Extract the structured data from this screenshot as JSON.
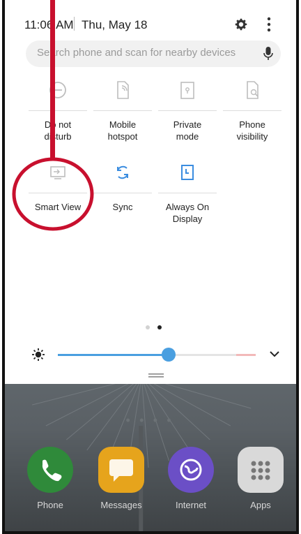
{
  "status_bar": {
    "time": "11:06 AM",
    "date": "Thu, May 18"
  },
  "search": {
    "placeholder": "Search phone and scan for nearby devices"
  },
  "tiles": [
    {
      "label": "Do not\ndisturb",
      "icon": "minus-circle-icon"
    },
    {
      "label": "Mobile\nhotspot",
      "icon": "hotspot-icon"
    },
    {
      "label": "Private\nmode",
      "icon": "private-mode-icon"
    },
    {
      "label": "Phone\nvisibility",
      "icon": "phone-visibility-icon"
    },
    {
      "label": "Smart View",
      "icon": "smart-view-icon"
    },
    {
      "label": "Sync",
      "icon": "sync-icon"
    },
    {
      "label": "Always On\nDisplay",
      "icon": "always-on-display-icon"
    }
  ],
  "page_indicator": {
    "pages": 2,
    "current": 2
  },
  "brightness": {
    "level_percent": 56
  },
  "home_apps": [
    {
      "label": "Phone",
      "icon": "phone-icon",
      "color": "#2f8a3a"
    },
    {
      "label": "Messages",
      "icon": "messages-icon",
      "color": "#e6a41c"
    },
    {
      "label": "Internet",
      "icon": "internet-icon",
      "color": "#6b4fc6"
    },
    {
      "label": "Apps",
      "icon": "apps-icon",
      "color": "#d9d9d9"
    }
  ],
  "colors": {
    "accent": "#4a9fe0",
    "annotation": "#c8102e"
  }
}
